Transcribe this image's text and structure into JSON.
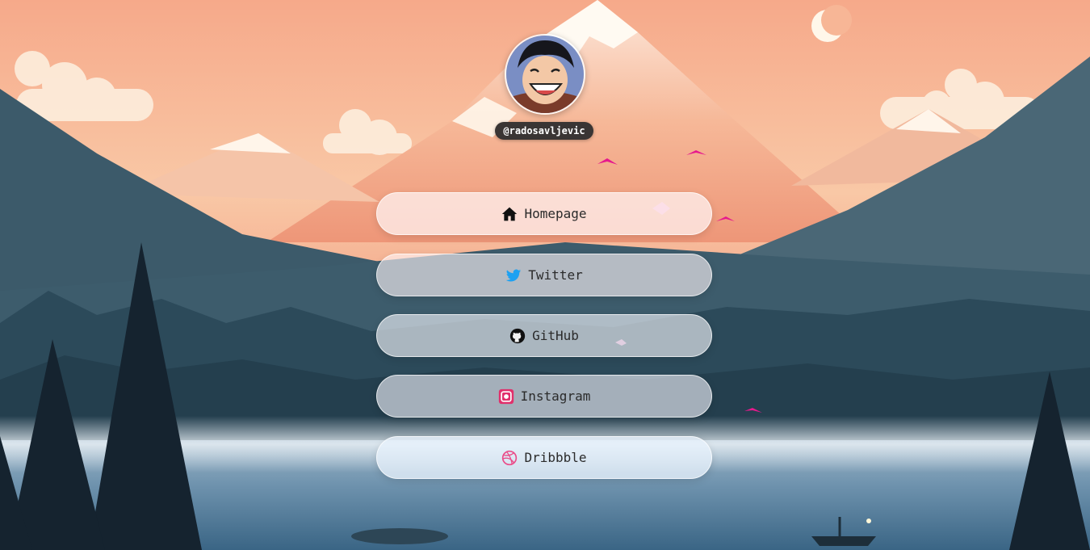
{
  "profile": {
    "handle": "@radosavljevic"
  },
  "links": [
    {
      "label": "Homepage",
      "icon": "home-icon",
      "color": "#111111"
    },
    {
      "label": "Twitter",
      "icon": "twitter-icon",
      "color": "#1da1f2"
    },
    {
      "label": "GitHub",
      "icon": "github-icon",
      "color": "#111111"
    },
    {
      "label": "Instagram",
      "icon": "instagram-icon",
      "color": "#e1306c"
    },
    {
      "label": "Dribbble",
      "icon": "dribbble-icon",
      "color": "#ea4c89"
    }
  ]
}
